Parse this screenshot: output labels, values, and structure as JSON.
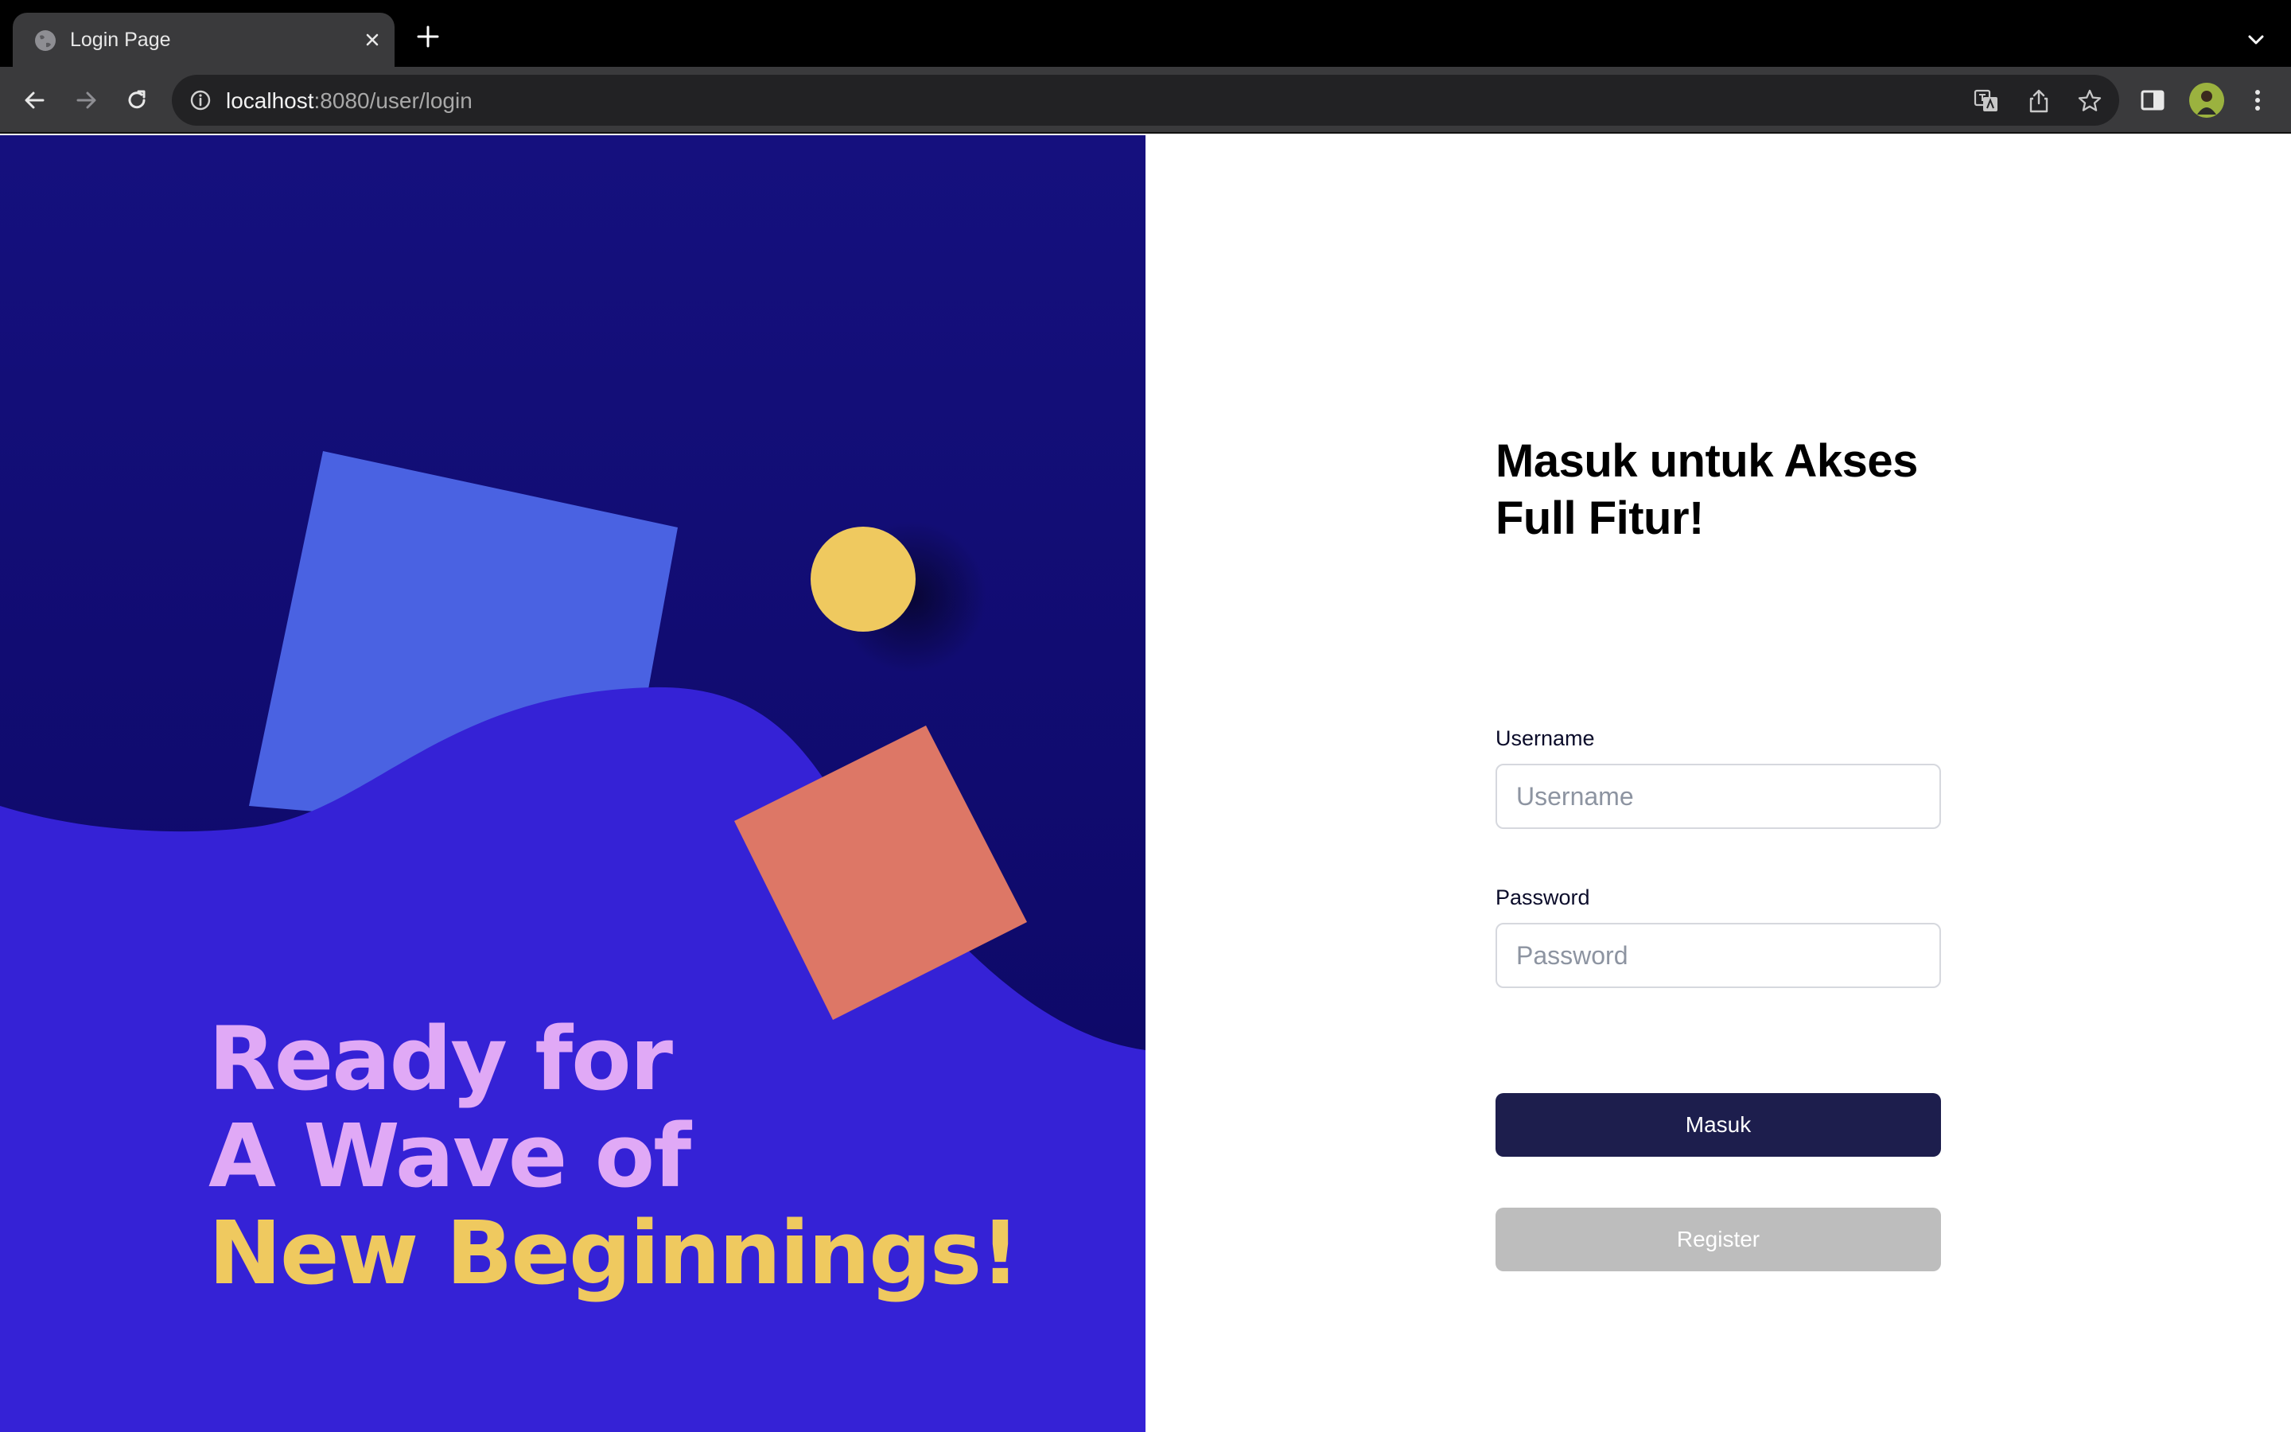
{
  "browser": {
    "tab_title": "Login Page",
    "url_host": "localhost",
    "url_rest": ":8080/user/login",
    "icons": {
      "favicon": "globe-icon",
      "tab_close": "close-icon",
      "new_tab": "plus-icon",
      "tab_search": "chevron-down-icon",
      "back": "arrow-left-icon",
      "forward": "arrow-right-icon",
      "reload": "reload-icon",
      "site_info": "info-icon",
      "translate": "translate-icon",
      "share": "share-icon",
      "bookmark": "star-icon",
      "side_panel": "side-panel-icon",
      "profile": "avatar",
      "menu": "kebab-menu-icon"
    }
  },
  "hero": {
    "line1": "Ready for",
    "line2": "A Wave of",
    "line3": "New Beginnings!",
    "colors": {
      "sky_top": "#15107e",
      "sky_bottom": "#0b0660",
      "wave": "#3522d6",
      "blue_square": "#4a62e2",
      "coral_square": "#dd7766",
      "sun": "#efc95f",
      "text_pink": "#e0a9f6",
      "text_gold": "#efc95f"
    }
  },
  "login": {
    "title_line1": "Masuk untuk Akses",
    "title_line2": "Full Fitur!",
    "username_label": "Username",
    "username_placeholder": "Username",
    "password_label": "Password",
    "password_placeholder": "Password",
    "submit_label": "Masuk",
    "register_label": "Register",
    "colors": {
      "primary_button": "#1d1e4d",
      "secondary_button": "#bdbdbd"
    }
  }
}
